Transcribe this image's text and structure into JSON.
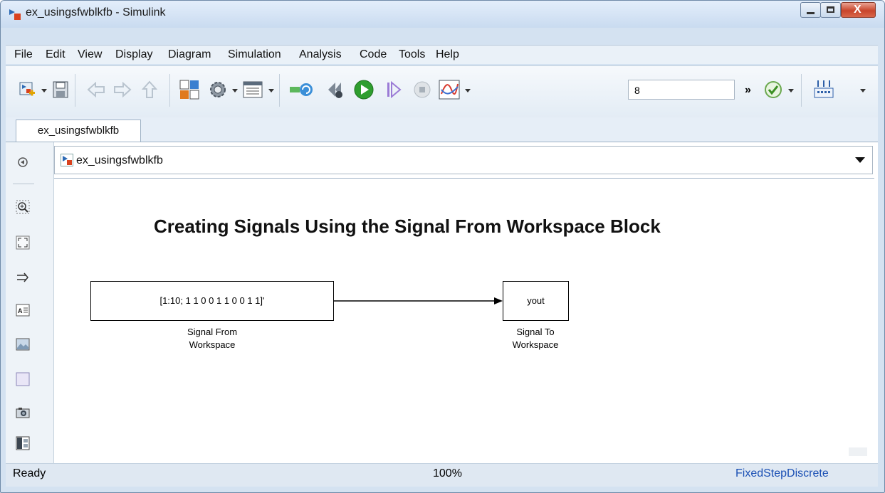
{
  "window": {
    "title": "ex_usingsfwblkfb - Simulink"
  },
  "menu": [
    "File",
    "Edit",
    "View",
    "Display",
    "Diagram",
    "Simulation",
    "Analysis",
    "Code",
    "Tools",
    "Help"
  ],
  "toolbar": {
    "stop_time": "8",
    "more": "»"
  },
  "tab": {
    "label": "ex_usingsfwblkfb"
  },
  "address": {
    "path": "ex_usingsfwblkfb"
  },
  "diagram": {
    "title": "Creating Signals Using the Signal From Workspace Block",
    "source_block": {
      "text": "[1:10; 1 1 0 0 1 1 0 0 1 1]'",
      "label_line1": "Signal From",
      "label_line2": "Workspace"
    },
    "sink_block": {
      "text": "yout",
      "label_line1": "Signal To",
      "label_line2": "Workspace"
    }
  },
  "status": {
    "state": "Ready",
    "zoom": "100%",
    "solver": "FixedStepDiscrete"
  },
  "colors": {
    "run_green": "#2f9e2f",
    "solver_link": "#1a4fb4"
  }
}
